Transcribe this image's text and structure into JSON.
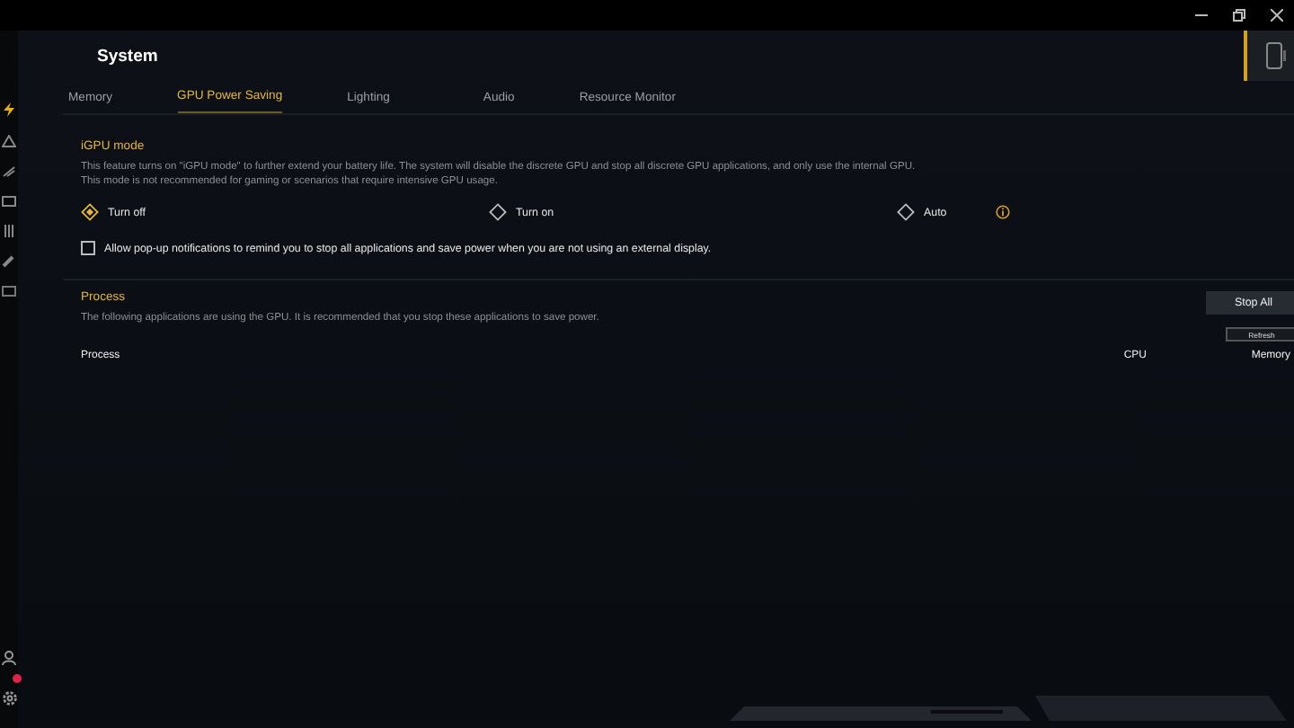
{
  "header": {
    "title": "System"
  },
  "tabs": [
    {
      "label": "Memory",
      "selected": false
    },
    {
      "label": "GPU Power Saving",
      "selected": true
    },
    {
      "label": "Lighting",
      "selected": false
    },
    {
      "label": "Audio",
      "selected": false
    },
    {
      "label": "Resource Monitor",
      "selected": false
    }
  ],
  "igpu": {
    "title": "iGPU mode",
    "description": [
      "This feature turns on \"iGPU mode\" to further extend your battery life. The system will disable the discrete GPU and stop all discrete GPU applications, and only use the internal GPU.",
      "This mode is not recommended for gaming or scenarios that require intensive GPU usage."
    ],
    "options": [
      {
        "label": "Turn off",
        "selected": true,
        "info": false
      },
      {
        "label": "Turn on",
        "selected": false,
        "info": false
      },
      {
        "label": "Auto",
        "selected": false,
        "info": true
      }
    ],
    "notification": {
      "label": "Allow pop-up notifications to remind you to stop all applications and save power when you are not using an external display.",
      "checked": false
    }
  },
  "process": {
    "title": "Process",
    "description": "The following applications are using the GPU. It is recommended that you stop these applications to save power.",
    "stop_button": "Stop All",
    "refresh_button": "Refresh",
    "columns": [
      "Process",
      "CPU",
      "Memory"
    ]
  }
}
